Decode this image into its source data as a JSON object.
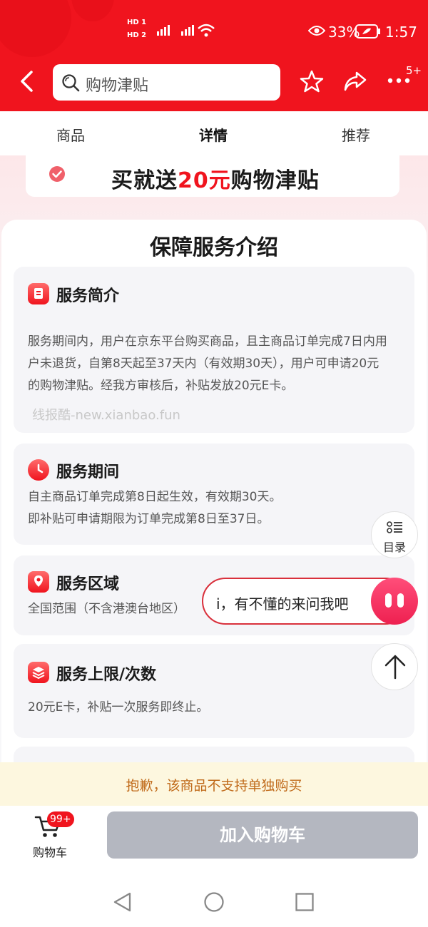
{
  "status_bar": {
    "signal_labels": [
      "HD 1",
      "HD 2"
    ],
    "battery": "33%",
    "time": "1:57"
  },
  "header": {
    "search_placeholder": "购物津贴",
    "more_badge": "5+"
  },
  "tabs": [
    {
      "label": "商品",
      "active": false
    },
    {
      "label": "详情",
      "active": true
    },
    {
      "label": "推荐",
      "active": false
    }
  ],
  "promo": {
    "prefix": "买就送",
    "highlight": "20元",
    "suffix": "购物津贴"
  },
  "guarantee": {
    "title": "保障服务介绍",
    "cards": [
      {
        "title": "服务简介",
        "lines": [
          "服务期间内，用户在京东平台购买商品，且主商品订单完成7日内用",
          "户未退货，自第8天起至37天内（有效期30天），用户可申请20元",
          "的购物津贴。经我方审核后，补贴发放20元E卡。"
        ],
        "watermark": "线报酷-new.xianbao.fun"
      },
      {
        "title": "服务期间",
        "lines": [
          "自主商品订单完成第8日起生效，有效期30天。",
          "即补贴可申请期限为订单完成第8日至37日。"
        ]
      },
      {
        "title": "服务区域",
        "lines": [
          "全国范围（不含港澳台地区）"
        ]
      },
      {
        "title": "服务上限/次数",
        "lines": [
          "20元E卡，补贴一次服务即终止。"
        ]
      }
    ]
  },
  "floating": {
    "toc_label": "目录",
    "assistant_text": "i，有不懂的来问我吧"
  },
  "notice": "抱歉，该商品不支持单独购买",
  "bottom": {
    "cart_label": "购物车",
    "cart_badge": "99+",
    "add_to_cart": "加入购物车"
  },
  "colors": {
    "brand_red": "#f0141e",
    "disabled_button": "#b4b7c0",
    "notice_bg": "#fdf7df",
    "notice_text": "#c06a1a"
  }
}
